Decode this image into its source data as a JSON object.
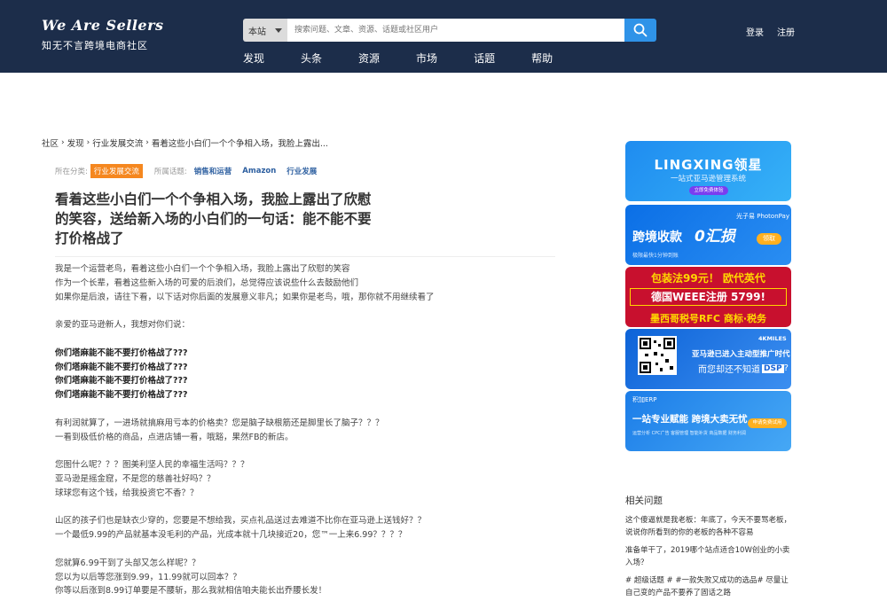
{
  "header": {
    "logo_title": "We Are Sellers",
    "logo_subtitle": "知无不言跨境电商社区",
    "search_scope": "本站",
    "search_placeholder": "搜索问题、文章、资源、话题或社区用户",
    "nav": [
      "发现",
      "头条",
      "资源",
      "市场",
      "话题",
      "帮助"
    ],
    "login": "登录",
    "register": "注册"
  },
  "breadcrumb": [
    "社区",
    "发现",
    "行业发展交流",
    "看着这些小白们一个个争相入场，我脸上露出..."
  ],
  "meta": {
    "category_label": "所在分类:",
    "category": "行业发展交流",
    "topics_label": "所属话题:",
    "topics": [
      "销售和运营",
      "Amazon",
      "行业发展"
    ]
  },
  "post": {
    "title": "看着这些小白们一个个争相入场，我脸上露出了欣慰的笑容，送给新入场的小白们的一句话：能不能不要打价格战了",
    "paragraphs": [
      [
        "我是一个运营老鸟，看着这些小白们一个个争相入场，我脸上露出了欣慰的笑容",
        "作为一个长辈，看着这些新入场的可爱的后浪们，总觉得应该说些什么去鼓励他们",
        "如果你是后浪，请往下看，以下话对你后面的发展意义非凡；如果你是老鸟，哦，那你就不用继续看了"
      ],
      [
        "亲爱的亚马逊新人，我想对你们说："
      ],
      [
        "你们塔麻能不能不要打价格战了???",
        "你们塔麻能不能不要打价格战了???",
        "你们塔麻能不能不要打价格战了???",
        "你们塔麻能不能不要打价格战了???"
      ],
      [
        "有利润就算了，一进场就搞麻用亏本的价格卖？您是脑子缺根筋还是脚里长了脑子？？？",
        "一看到极低价格的商品，点进店铺一看，哦豁，果然FB的新店。"
      ],
      [
        "您图什么呢？？？图美利坚人民的幸福生活吗？？？",
        "亚马逊是摇金窟，不是您的慈善社好吗？？",
        "球球您有这个钱，给我投资它不香？？"
      ],
      [
        "山区的孩子们也是缺衣少穿的，您要是不想给我，买点礼品送过去难道不比你在亚马逊上送钱好？？",
        "一个最低9.99的产品就基本没毛利的产品，光成本就十几块接近20，您™一上来6.99？？？？"
      ],
      [
        "您就算6.99干到了头部又怎么样呢？？",
        "您以为以后等您涨到9.99，11.99就可以回本？？",
        "你等以后涨到8.99订单要是不腰斩，那么我就相信咱夫能长出乔腰长发！"
      ]
    ]
  },
  "ads": [
    {
      "brand": "LINGXING领星",
      "tagline": "一站式亚马逊管理系统",
      "cta": "立即免费体验"
    },
    {
      "headline": "跨境收款",
      "accent": "0汇损",
      "brand": "光子易 PhotonPay",
      "cta": "领取",
      "sub": "极限最快1分钟到账"
    },
    {
      "line1": "包装法99元！ 欧代英代",
      "line2": "德国WEEE注册 5799!",
      "line3": "墨西哥税号RFC  商标·税务"
    },
    {
      "brand": "4KMILES",
      "line1": "亚马逊已进入主动型推广时代",
      "line2": "而您却还不知道",
      "badge": "DSP",
      "end": "?"
    },
    {
      "brand": "积加ERP",
      "line1": "一站专业赋能  跨境大卖无忧",
      "sub": "运营分析 CPC广告 客服管理 智能补货 商品数据 财务利润",
      "cta": "申请免费试用"
    }
  ],
  "related": {
    "title": "相关问题",
    "items": [
      "这个傻逼就是我老板：年底了，今天不要骂老板，说说你所看到的你的老板的各种不容易",
      "准备单干了，2019哪个站点适合10W创业的小卖入场？",
      "# 超级话题 # #一款失败又成功的选品# 尽量让自己变的产品不要养了固话之路"
    ]
  }
}
